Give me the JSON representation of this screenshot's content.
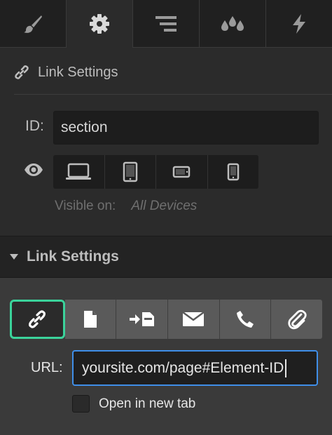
{
  "tabs": [
    {
      "icon": "brush-icon",
      "active": false
    },
    {
      "icon": "gear-icon",
      "active": true
    },
    {
      "icon": "navigator-icon",
      "active": false
    },
    {
      "icon": "drops-icon",
      "active": false
    },
    {
      "icon": "lightning-icon",
      "active": false
    }
  ],
  "element_settings": {
    "heading": "Link Settings",
    "id_label": "ID:",
    "id_value": "section",
    "visible_on_label": "Visible on:",
    "visible_on_value": "All Devices",
    "devices": [
      "desktop-icon",
      "tablet-icon",
      "mobile-landscape-icon",
      "mobile-portrait-icon"
    ]
  },
  "link_settings": {
    "heading": "Link Settings",
    "link_types": [
      "url-link-icon",
      "page-icon",
      "section-link-icon",
      "email-icon",
      "phone-icon",
      "attachment-icon"
    ],
    "url_label": "URL:",
    "url_value": "yoursite.com/page#Element-ID",
    "open_new_tab_label": "Open in new tab",
    "open_new_tab_checked": false
  },
  "colors": {
    "accent_active": "#3bd39b",
    "input_focus": "#3f8ee8",
    "panel_bg": "#2b2b2b"
  }
}
